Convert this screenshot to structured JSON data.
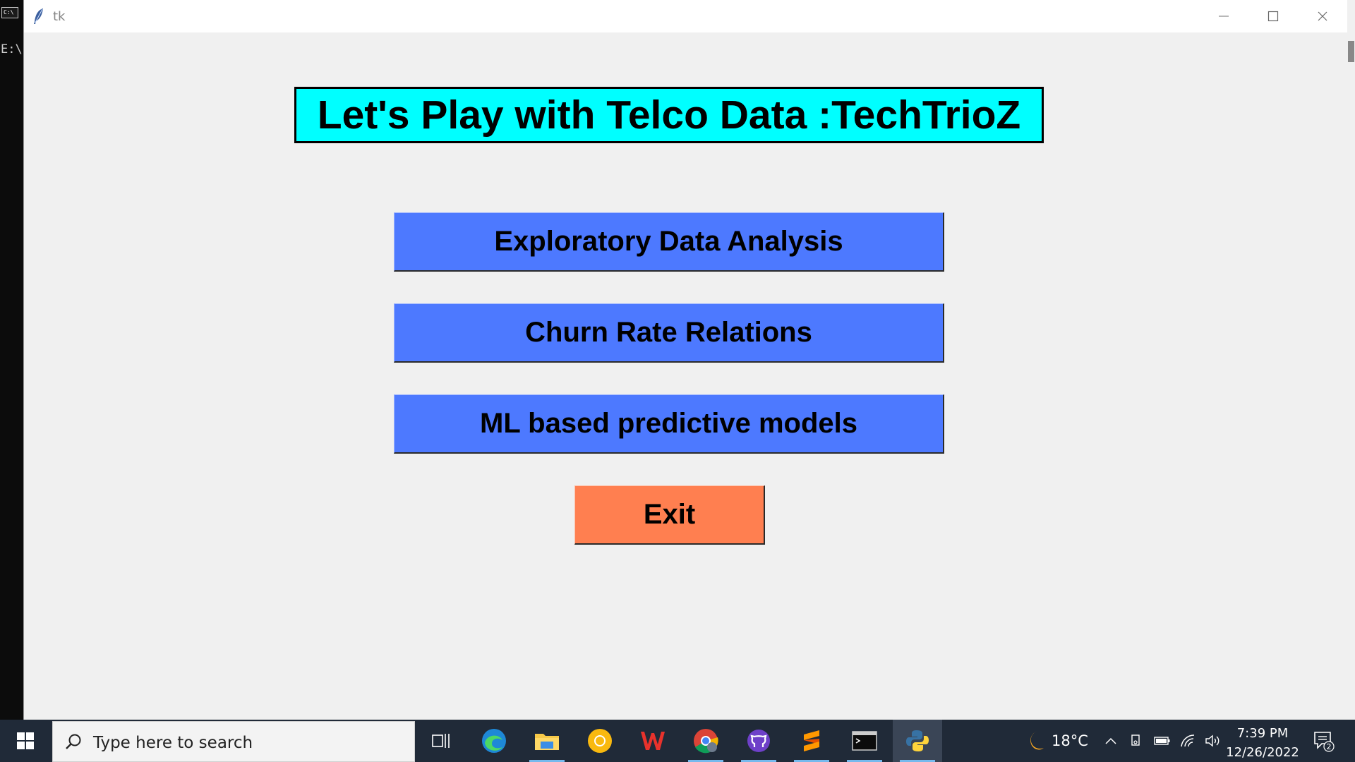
{
  "console": {
    "prompt_fragment": "E:\\",
    "icon_text": "C:\\"
  },
  "window": {
    "title": "tk"
  },
  "app": {
    "banner": "Let's Play with Telco Data :TechTrioZ",
    "buttons": [
      {
        "label": "Exploratory Data Analysis"
      },
      {
        "label": "Churn Rate Relations"
      },
      {
        "label": "ML based predictive models"
      }
    ],
    "exit_label": "Exit",
    "colors": {
      "banner_bg": "#00ffff",
      "button_bg": "#4d79ff",
      "exit_bg": "#ff7f50",
      "window_bg": "#f0f0f0"
    }
  },
  "taskbar": {
    "search_placeholder": "Type here to search",
    "apps": [
      "task-view",
      "edge",
      "file-explorer",
      "chrome-canary",
      "wps-office",
      "chrome",
      "github-desktop",
      "sublime-text",
      "terminal",
      "python"
    ],
    "weather": "18°C",
    "time": "7:39 PM",
    "date": "12/26/2022",
    "notification_count": "2"
  }
}
